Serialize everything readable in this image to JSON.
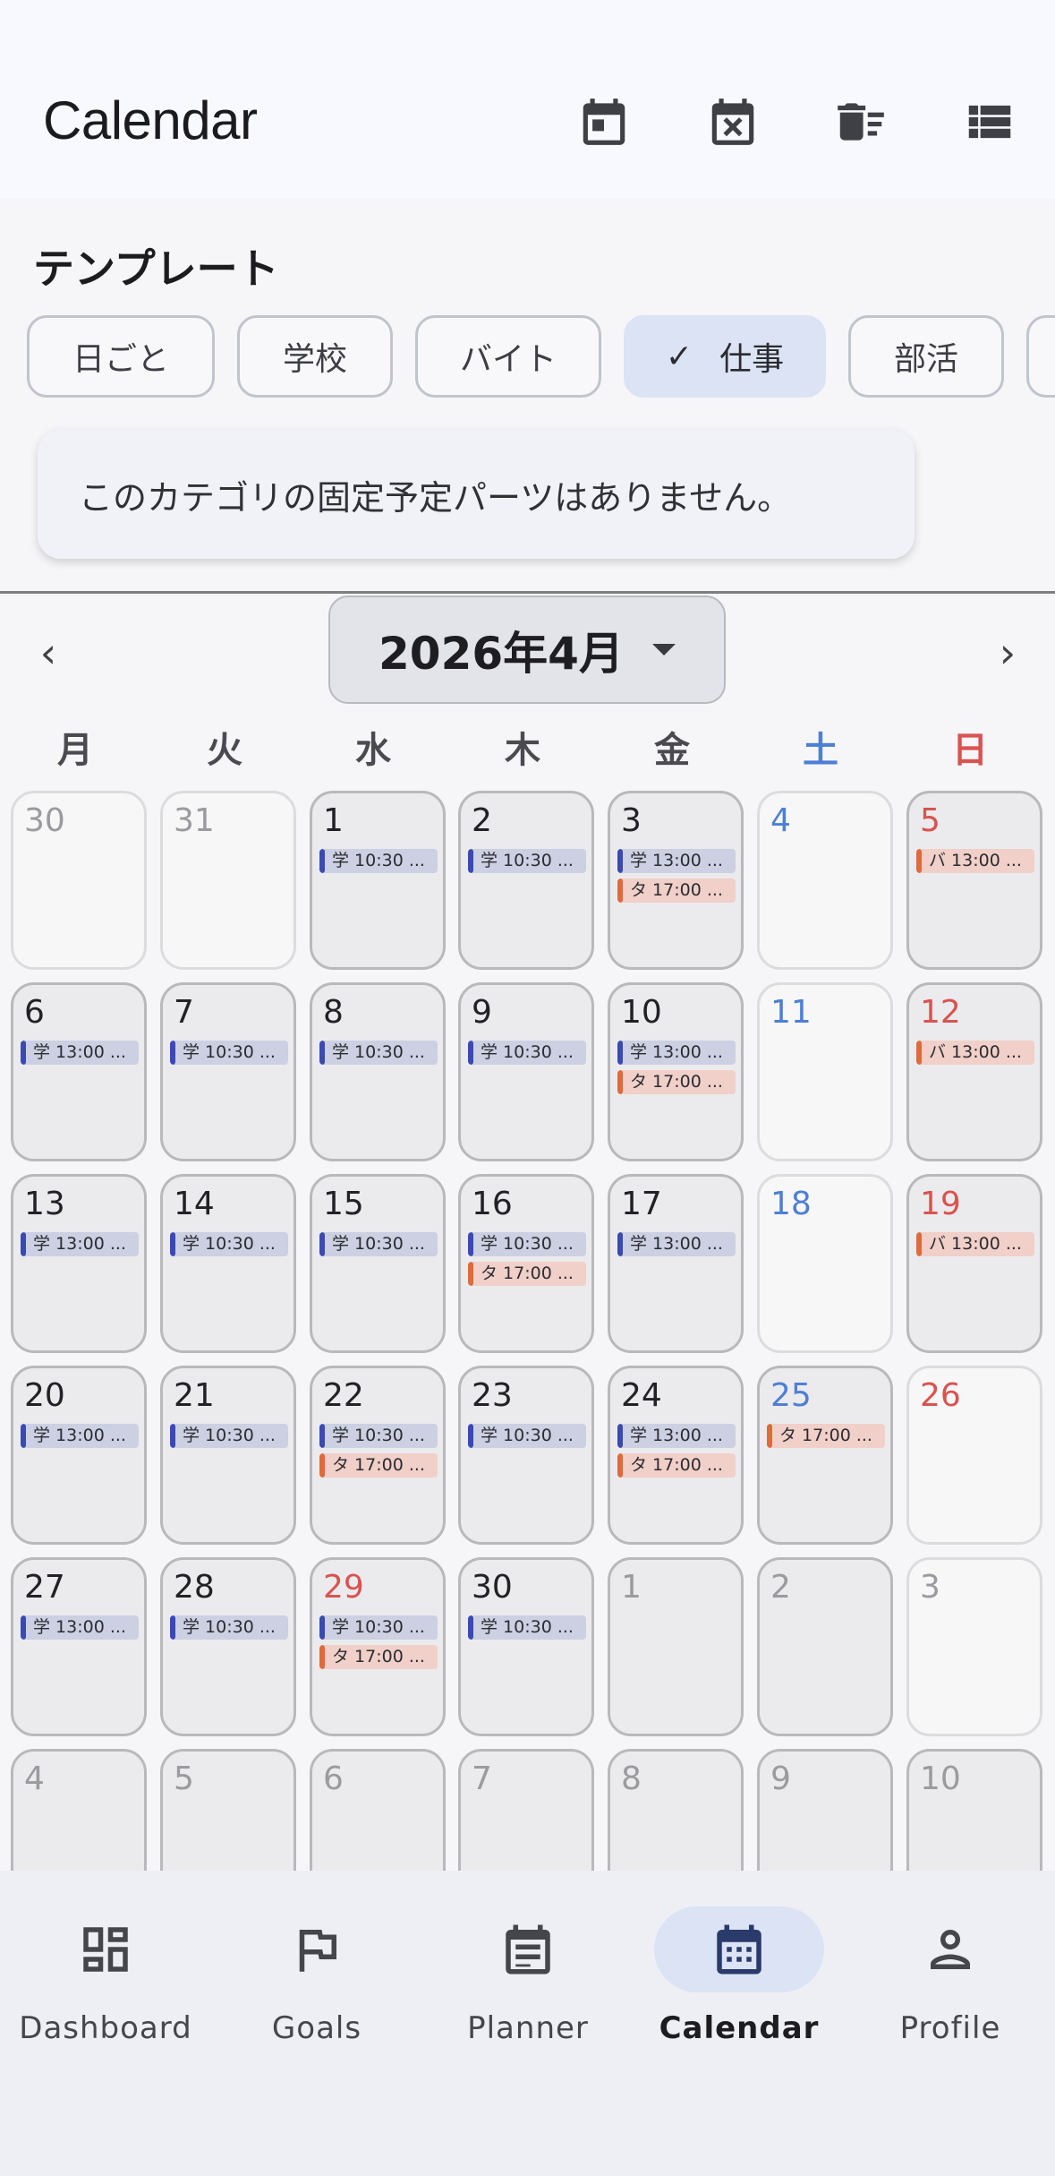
{
  "app_bar": {
    "title": "Calendar",
    "actions": [
      "calendar-today-icon",
      "calendar-clear-icon",
      "delete-sweep-icon",
      "list-view-icon"
    ]
  },
  "template": {
    "title": "テンプレート",
    "chips": [
      {
        "label": "日ごと",
        "selected": false
      },
      {
        "label": "学校",
        "selected": false
      },
      {
        "label": "バイト",
        "selected": false
      },
      {
        "label": "仕事",
        "selected": true
      },
      {
        "label": "部活",
        "selected": false
      }
    ],
    "notice": "このカテゴリの固定予定パーツはありません。"
  },
  "month": {
    "label": "2026年4月",
    "prev": "‹",
    "next": "›"
  },
  "weekdays": [
    "月",
    "火",
    "水",
    "木",
    "金",
    "土",
    "日"
  ],
  "calendar": {
    "weeks": [
      [
        {
          "day": "30",
          "muted": true,
          "empty": true,
          "events": []
        },
        {
          "day": "31",
          "muted": true,
          "empty": true,
          "events": []
        },
        {
          "day": "1",
          "events": [
            {
              "text": "学 10:30 ...",
              "kind": "school"
            }
          ]
        },
        {
          "day": "2",
          "events": [
            {
              "text": "学 10:30 ...",
              "kind": "school"
            }
          ]
        },
        {
          "day": "3",
          "events": [
            {
              "text": "学 13:00 ...",
              "kind": "school"
            },
            {
              "text": "タ 17:00 ...",
              "kind": "orange"
            }
          ]
        },
        {
          "day": "4",
          "empty": true,
          "events": []
        },
        {
          "day": "5",
          "events": [
            {
              "text": "バ 13:00 ...",
              "kind": "orange"
            }
          ]
        }
      ],
      [
        {
          "day": "6",
          "events": [
            {
              "text": "学 13:00 ...",
              "kind": "school"
            }
          ]
        },
        {
          "day": "7",
          "events": [
            {
              "text": "学 10:30 ...",
              "kind": "school"
            }
          ]
        },
        {
          "day": "8",
          "events": [
            {
              "text": "学 10:30 ...",
              "kind": "school"
            }
          ]
        },
        {
          "day": "9",
          "events": [
            {
              "text": "学 10:30 ...",
              "kind": "school"
            }
          ]
        },
        {
          "day": "10",
          "events": [
            {
              "text": "学 13:00 ...",
              "kind": "school"
            },
            {
              "text": "タ 17:00 ...",
              "kind": "orange"
            }
          ]
        },
        {
          "day": "11",
          "empty": true,
          "events": []
        },
        {
          "day": "12",
          "events": [
            {
              "text": "バ 13:00 ...",
              "kind": "orange"
            }
          ]
        }
      ],
      [
        {
          "day": "13",
          "events": [
            {
              "text": "学 13:00 ...",
              "kind": "school"
            }
          ]
        },
        {
          "day": "14",
          "events": [
            {
              "text": "学 10:30 ...",
              "kind": "school"
            }
          ]
        },
        {
          "day": "15",
          "events": [
            {
              "text": "学 10:30 ...",
              "kind": "school"
            }
          ]
        },
        {
          "day": "16",
          "events": [
            {
              "text": "学 10:30 ...",
              "kind": "school"
            },
            {
              "text": "タ 17:00 ...",
              "kind": "orange"
            }
          ]
        },
        {
          "day": "17",
          "events": [
            {
              "text": "学 13:00 ...",
              "kind": "school"
            }
          ]
        },
        {
          "day": "18",
          "empty": true,
          "events": []
        },
        {
          "day": "19",
          "events": [
            {
              "text": "バ 13:00 ...",
              "kind": "orange"
            }
          ]
        }
      ],
      [
        {
          "day": "20",
          "events": [
            {
              "text": "学 13:00 ...",
              "kind": "school"
            }
          ]
        },
        {
          "day": "21",
          "events": [
            {
              "text": "学 10:30 ...",
              "kind": "school"
            }
          ]
        },
        {
          "day": "22",
          "events": [
            {
              "text": "学 10:30 ...",
              "kind": "school"
            },
            {
              "text": "タ 17:00 ...",
              "kind": "orange"
            }
          ]
        },
        {
          "day": "23",
          "events": [
            {
              "text": "学 10:30 ...",
              "kind": "school"
            }
          ]
        },
        {
          "day": "24",
          "events": [
            {
              "text": "学 13:00 ...",
              "kind": "school"
            },
            {
              "text": "タ 17:00 ...",
              "kind": "orange"
            }
          ]
        },
        {
          "day": "25",
          "events": [
            {
              "text": "タ 17:00 ...",
              "kind": "orange"
            }
          ]
        },
        {
          "day": "26",
          "empty": true,
          "events": []
        }
      ],
      [
        {
          "day": "27",
          "events": [
            {
              "text": "学 13:00 ...",
              "kind": "school"
            }
          ]
        },
        {
          "day": "28",
          "events": [
            {
              "text": "学 10:30 ...",
              "kind": "school"
            }
          ]
        },
        {
          "day": "29",
          "holiday": true,
          "events": [
            {
              "text": "学 10:30 ...",
              "kind": "school"
            },
            {
              "text": "タ 17:00 ...",
              "kind": "orange"
            }
          ]
        },
        {
          "day": "30",
          "events": [
            {
              "text": "学 10:30 ...",
              "kind": "school"
            }
          ]
        },
        {
          "day": "1",
          "muted": true,
          "events": []
        },
        {
          "day": "2",
          "muted": true,
          "events": []
        },
        {
          "day": "3",
          "muted": true,
          "empty": true,
          "events": []
        }
      ],
      [
        {
          "day": "4",
          "muted": true,
          "events": []
        },
        {
          "day": "5",
          "muted": true,
          "events": []
        },
        {
          "day": "6",
          "muted": true,
          "events": []
        },
        {
          "day": "7",
          "muted": true,
          "events": []
        },
        {
          "day": "8",
          "muted": true,
          "events": []
        },
        {
          "day": "9",
          "muted": true,
          "events": []
        },
        {
          "day": "10",
          "muted": true,
          "events": []
        }
      ]
    ]
  },
  "bottom_nav": [
    {
      "label": "Dashboard",
      "icon": "dashboard-icon",
      "active": false
    },
    {
      "label": "Goals",
      "icon": "flag-icon",
      "active": false
    },
    {
      "label": "Planner",
      "icon": "planner-icon",
      "active": false
    },
    {
      "label": "Calendar",
      "icon": "calendar-month-icon",
      "active": true
    },
    {
      "label": "Profile",
      "icon": "person-icon",
      "active": false
    }
  ],
  "colors": {
    "accent_container": "#dbe3f5",
    "school_bar": "#3b4ab0",
    "orange_bar": "#e06a3a",
    "saturday": "#4d7fd6",
    "sunday": "#d9534f"
  }
}
